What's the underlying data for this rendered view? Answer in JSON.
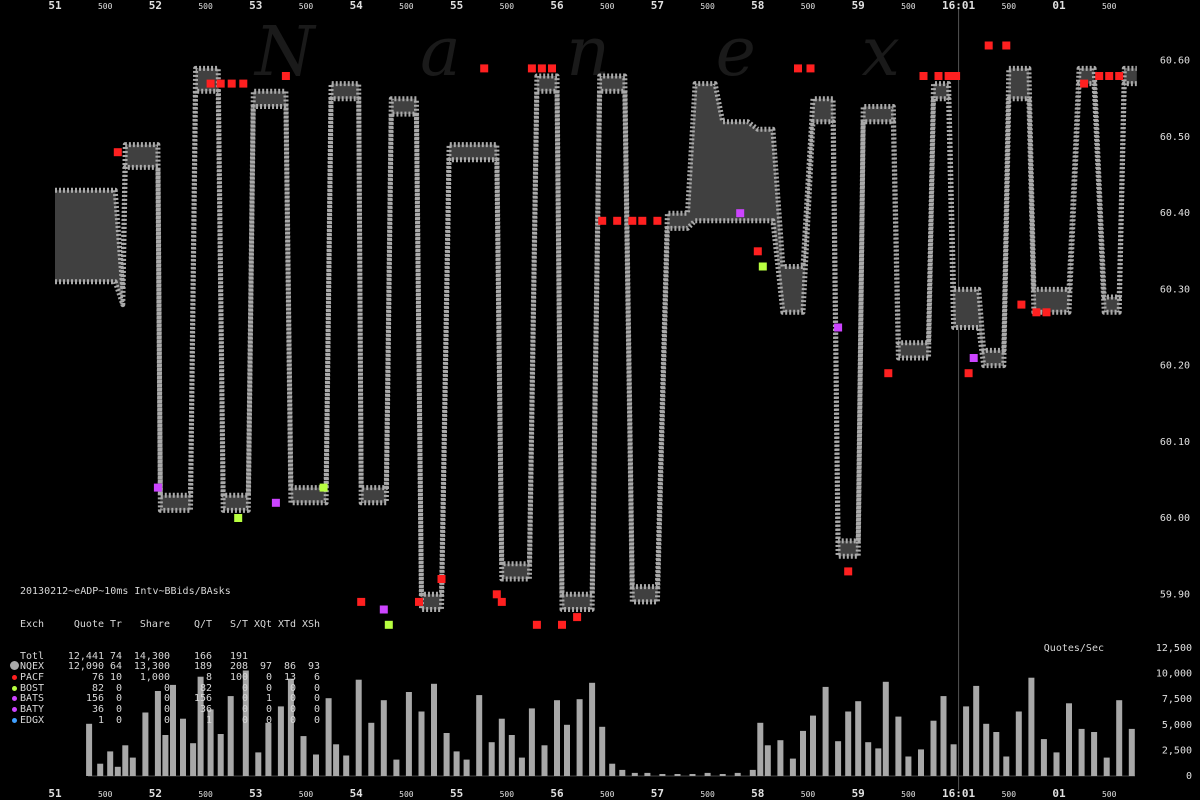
{
  "chart_data": [
    {
      "type": "line",
      "watermark": "N a n e x",
      "title": "20130212~eADP~10ms Intv~BBids/BAsks",
      "x_tick_labels": [
        "51",
        "500",
        "52",
        "500",
        "53",
        "500",
        "54",
        "500",
        "55",
        "500",
        "56",
        "500",
        "57",
        "500",
        "58",
        "500",
        "59",
        "500",
        "16:01",
        "500",
        "01",
        "500"
      ],
      "y_tick_labels": [
        "60.60",
        "60.50",
        "60.40",
        "60.30",
        "60.20",
        "60.10",
        "60.00",
        "59.90"
      ],
      "ylim": [
        59.84,
        60.66
      ],
      "series": [
        {
          "name": "NQEX",
          "color": "#aaaaaa",
          "x": [
            0,
            0.62,
            1.2,
            1.35,
            1.4,
            2.05,
            2.1,
            2.7,
            2.8,
            3.25,
            3.35,
            3.85,
            3.95,
            4.6,
            4.7,
            5.4,
            5.5,
            6.05,
            6.1,
            6.6,
            6.7,
            7.2,
            7.3,
            7.7,
            7.85,
            8.8,
            8.9,
            9.45,
            9.6,
            10.0,
            10.1,
            10.7,
            10.85,
            11.35,
            11.5,
            12.0,
            12.2,
            12.6,
            12.75,
            13.15,
            13.3,
            13.8,
            14.0,
            14.3,
            14.5,
            14.9,
            15.1,
            15.5,
            15.6,
            16.0,
            16.1,
            16.7,
            16.8,
            17.4,
            17.5,
            17.8,
            17.9,
            18.4,
            18.5,
            18.9,
            19.0,
            19.4,
            19.5,
            19.8,
            19.9,
            20.2,
            20.4,
            20.7,
            20.9,
            21.2,
            21.3,
            21.55
          ],
          "bid": [
            60.31,
            60.31,
            60.31,
            60.28,
            60.46,
            60.46,
            60.01,
            60.01,
            60.56,
            60.56,
            60.01,
            60.01,
            60.54,
            60.54,
            60.02,
            60.02,
            60.55,
            60.55,
            60.02,
            60.02,
            60.53,
            60.53,
            59.88,
            59.88,
            60.47,
            60.47,
            59.92,
            59.92,
            60.56,
            60.56,
            59.88,
            59.88,
            60.56,
            60.56,
            59.89,
            59.89,
            60.38,
            60.38,
            60.39,
            60.39,
            60.39,
            60.39,
            60.39,
            60.39,
            60.27,
            60.27,
            60.52,
            60.52,
            59.95,
            59.95,
            60.52,
            60.52,
            60.21,
            60.21,
            60.55,
            60.55,
            60.25,
            60.25,
            60.2,
            60.2,
            60.55,
            60.55,
            60.27,
            60.27,
            60.27,
            60.27,
            60.57,
            60.57,
            60.27,
            60.27,
            60.57,
            60.57
          ],
          "ask": [
            60.43,
            60.43,
            60.43,
            60.3,
            60.49,
            60.49,
            60.03,
            60.03,
            60.59,
            60.59,
            60.03,
            60.03,
            60.56,
            60.56,
            60.04,
            60.04,
            60.57,
            60.57,
            60.04,
            60.04,
            60.55,
            60.55,
            59.9,
            59.9,
            60.49,
            60.49,
            59.94,
            59.94,
            60.58,
            60.58,
            59.9,
            59.9,
            60.58,
            60.58,
            59.91,
            59.91,
            60.4,
            60.4,
            60.57,
            60.57,
            60.52,
            60.52,
            60.51,
            60.51,
            60.33,
            60.33,
            60.55,
            60.55,
            59.97,
            59.97,
            60.54,
            60.54,
            60.23,
            60.23,
            60.57,
            60.57,
            60.3,
            60.3,
            60.22,
            60.22,
            60.59,
            60.59,
            60.3,
            60.3,
            60.3,
            60.3,
            60.59,
            60.59,
            60.29,
            60.29,
            60.59,
            60.59
          ]
        }
      ],
      "markers": [
        {
          "x": 1.25,
          "y": 60.48,
          "color": "#ff2020"
        },
        {
          "x": 2.05,
          "y": 60.04,
          "color": "#cc44ff"
        },
        {
          "x": 3.1,
          "y": 60.57,
          "color": "#ff2020"
        },
        {
          "x": 3.3,
          "y": 60.57,
          "color": "#ff2020"
        },
        {
          "x": 3.52,
          "y": 60.57,
          "color": "#ff2020"
        },
        {
          "x": 3.75,
          "y": 60.57,
          "color": "#ff2020"
        },
        {
          "x": 3.65,
          "y": 60.0,
          "color": "#b8ff40"
        },
        {
          "x": 4.6,
          "y": 60.58,
          "color": "#ff2020"
        },
        {
          "x": 4.4,
          "y": 60.02,
          "color": "#cc44ff"
        },
        {
          "x": 5.35,
          "y": 60.04,
          "color": "#b8ff40"
        },
        {
          "x": 6.1,
          "y": 59.89,
          "color": "#ff2020"
        },
        {
          "x": 6.55,
          "y": 59.88,
          "color": "#cc44ff"
        },
        {
          "x": 6.65,
          "y": 59.86,
          "color": "#b8ff40"
        },
        {
          "x": 7.25,
          "y": 59.89,
          "color": "#ff2020"
        },
        {
          "x": 7.7,
          "y": 59.92,
          "color": "#ff2020"
        },
        {
          "x": 8.55,
          "y": 60.59,
          "color": "#ff2020"
        },
        {
          "x": 8.8,
          "y": 59.9,
          "color": "#ff2020"
        },
        {
          "x": 8.9,
          "y": 59.89,
          "color": "#ff2020"
        },
        {
          "x": 9.5,
          "y": 60.59,
          "color": "#ff2020"
        },
        {
          "x": 9.7,
          "y": 60.59,
          "color": "#ff2020"
        },
        {
          "x": 9.9,
          "y": 60.59,
          "color": "#ff2020"
        },
        {
          "x": 9.6,
          "y": 59.86,
          "color": "#ff2020"
        },
        {
          "x": 10.1,
          "y": 59.86,
          "color": "#ff2020"
        },
        {
          "x": 10.4,
          "y": 59.87,
          "color": "#ff2020"
        },
        {
          "x": 10.9,
          "y": 60.39,
          "color": "#ff2020"
        },
        {
          "x": 11.2,
          "y": 60.39,
          "color": "#ff2020"
        },
        {
          "x": 11.5,
          "y": 60.39,
          "color": "#ff2020"
        },
        {
          "x": 11.7,
          "y": 60.39,
          "color": "#ff2020"
        },
        {
          "x": 12.0,
          "y": 60.39,
          "color": "#ff2020"
        },
        {
          "x": 13.65,
          "y": 60.4,
          "color": "#cc44ff"
        },
        {
          "x": 14.0,
          "y": 60.35,
          "color": "#ff2020"
        },
        {
          "x": 14.1,
          "y": 60.33,
          "color": "#b8ff40"
        },
        {
          "x": 14.8,
          "y": 60.59,
          "color": "#ff2020"
        },
        {
          "x": 15.05,
          "y": 60.59,
          "color": "#ff2020"
        },
        {
          "x": 15.6,
          "y": 60.25,
          "color": "#cc44ff"
        },
        {
          "x": 15.8,
          "y": 59.93,
          "color": "#ff2020"
        },
        {
          "x": 16.6,
          "y": 60.19,
          "color": "#ff2020"
        },
        {
          "x": 17.3,
          "y": 60.58,
          "color": "#ff2020"
        },
        {
          "x": 17.6,
          "y": 60.58,
          "color": "#ff2020"
        },
        {
          "x": 17.8,
          "y": 60.58,
          "color": "#ff2020"
        },
        {
          "x": 17.95,
          "y": 60.58,
          "color": "#ff2020"
        },
        {
          "x": 18.2,
          "y": 60.19,
          "color": "#ff2020"
        },
        {
          "x": 18.3,
          "y": 60.21,
          "color": "#cc44ff"
        },
        {
          "x": 18.6,
          "y": 60.62,
          "color": "#ff2020"
        },
        {
          "x": 18.95,
          "y": 60.62,
          "color": "#ff2020"
        },
        {
          "x": 19.25,
          "y": 60.28,
          "color": "#ff2020"
        },
        {
          "x": 19.55,
          "y": 60.27,
          "color": "#ff2020"
        },
        {
          "x": 19.75,
          "y": 60.27,
          "color": "#ff2020"
        },
        {
          "x": 20.5,
          "y": 60.57,
          "color": "#ff2020"
        },
        {
          "x": 20.8,
          "y": 60.58,
          "color": "#ff2020"
        },
        {
          "x": 21.0,
          "y": 60.58,
          "color": "#ff2020"
        },
        {
          "x": 21.2,
          "y": 60.58,
          "color": "#ff2020"
        }
      ]
    },
    {
      "type": "bar",
      "title": "Quotes/Sec",
      "y_tick_labels": [
        "12,500",
        "10,000",
        "7,500",
        "5,000",
        "2,500",
        "0"
      ],
      "ylim": [
        0,
        12500
      ],
      "x": [
        0.68,
        0.9,
        1.1,
        1.25,
        1.4,
        1.55,
        1.8,
        2.05,
        2.2,
        2.35,
        2.55,
        2.75,
        2.9,
        3.1,
        3.3,
        3.5,
        3.8,
        4.05,
        4.25,
        4.5,
        4.7,
        4.95,
        5.2,
        5.45,
        5.6,
        5.8,
        6.05,
        6.3,
        6.55,
        6.8,
        7.05,
        7.3,
        7.55,
        7.8,
        8.0,
        8.2,
        8.45,
        8.7,
        8.9,
        9.1,
        9.3,
        9.5,
        9.75,
        10.0,
        10.2,
        10.45,
        10.7,
        10.9,
        11.1,
        11.3,
        11.55,
        11.8,
        12.1,
        12.4,
        12.7,
        13.0,
        13.3,
        13.6,
        13.9,
        14.05,
        14.2,
        14.45,
        14.7,
        14.9,
        15.1,
        15.35,
        15.6,
        15.8,
        16.0,
        16.2,
        16.4,
        16.55,
        16.8,
        17.0,
        17.25,
        17.5,
        17.7,
        17.9,
        18.15,
        18.35,
        18.55,
        18.75,
        18.95,
        19.2,
        19.45,
        19.7,
        19.95,
        20.2,
        20.45,
        20.7,
        20.95,
        21.2,
        21.45
      ],
      "values": [
        5100,
        1200,
        2400,
        900,
        3000,
        1800,
        6200,
        8300,
        4000,
        8900,
        5600,
        3200,
        9700,
        6500,
        4100,
        7800,
        10300,
        2300,
        5200,
        6800,
        9500,
        3900,
        2100,
        7600,
        3100,
        2000,
        9400,
        5200,
        7400,
        1600,
        8200,
        6300,
        9000,
        4200,
        2400,
        1600,
        7900,
        3300,
        5600,
        4000,
        1800,
        6600,
        3000,
        7400,
        5000,
        7500,
        9100,
        4800,
        1200,
        600,
        300,
        300,
        200,
        200,
        200,
        300,
        200,
        300,
        600,
        5200,
        3000,
        3500,
        1700,
        4400,
        5900,
        8700,
        3400,
        6300,
        7300,
        3300,
        2700,
        9200,
        5800,
        1900,
        2600,
        5400,
        7800,
        3100,
        6800,
        8800,
        5100,
        4300,
        1900,
        6300,
        9600,
        3600,
        2300,
        7100,
        4600,
        4300,
        1800,
        7400,
        4600
      ]
    },
    {
      "type": "table",
      "title": "20130212~eADP~10ms Intv~BBids/BAsks",
      "columns": [
        "Exch",
        "Quote",
        "Tr",
        "Share",
        "Q/T",
        "S/T",
        "XQt",
        "XTd",
        "XSh"
      ],
      "rows": [
        {
          "marker_color": "",
          "cells": [
            "Totl",
            "12,441",
            "74",
            "14,300",
            "166",
            "191",
            "",
            "",
            ""
          ]
        },
        {
          "marker_color": "#aaaaaa",
          "cells": [
            "NQEX",
            "12,090",
            "64",
            "13,300",
            "189",
            "208",
            "97",
            "86",
            "93"
          ]
        },
        {
          "marker_color": "#ff2020",
          "cells": [
            "PACF",
            "76",
            "10",
            "1,000",
            "8",
            "100",
            "0",
            "13",
            "6"
          ]
        },
        {
          "marker_color": "#b8ff40",
          "cells": [
            "BOST",
            "82",
            "0",
            "0",
            "82",
            "0",
            "0",
            "0",
            "0"
          ]
        },
        {
          "marker_color": "#cc44ff",
          "cells": [
            "BATS",
            "156",
            "0",
            "0",
            "156",
            "0",
            "1",
            "0",
            "0"
          ]
        },
        {
          "marker_color": "#cc44ff",
          "cells": [
            "BATY",
            "36",
            "0",
            "0",
            "36",
            "0",
            "0",
            "0",
            "0"
          ]
        },
        {
          "marker_color": "#40a0ff",
          "cells": [
            "EDGX",
            "1",
            "0",
            "0",
            "1",
            "0",
            "0",
            "0",
            "0"
          ]
        }
      ]
    }
  ]
}
